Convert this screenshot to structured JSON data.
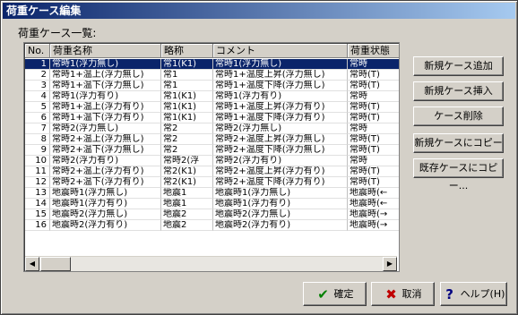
{
  "window": {
    "title": "荷重ケース編集"
  },
  "list_label": "荷重ケース一覧:",
  "columns": [
    "No.",
    "荷重名称",
    "略称",
    "コメント",
    "荷重状態"
  ],
  "rows": [
    [
      "1",
      "常時1(浮力無し)",
      "常1(K1)",
      "常時1(浮力無し)",
      "常時"
    ],
    [
      "2",
      "常時1+温上(浮力無し)",
      "常1",
      "常時1+温度上昇(浮力無し)",
      "常時(T)"
    ],
    [
      "3",
      "常時1+温下(浮力無し)",
      "常1",
      "常時1+温度下降(浮力無し)",
      "常時(T)"
    ],
    [
      "4",
      "常時1(浮力有り)",
      "常1(K1)",
      "常時1(浮力有り)",
      "常時"
    ],
    [
      "5",
      "常時1+温上(浮力有り)",
      "常1(K1)",
      "常時1+温度上昇(浮力有り)",
      "常時(T)"
    ],
    [
      "6",
      "常時1+温下(浮力有り)",
      "常1(K1)",
      "常時1+温度下降(浮力有り)",
      "常時(T)"
    ],
    [
      "7",
      "常時2(浮力無し)",
      "常2",
      "常時2(浮力無し)",
      "常時"
    ],
    [
      "8",
      "常時2+温上(浮力無し)",
      "常2",
      "常時2+温度上昇(浮力無し)",
      "常時(T)"
    ],
    [
      "9",
      "常時2+温下(浮力無し)",
      "常2",
      "常時2+温度下降(浮力無し)",
      "常時(T)"
    ],
    [
      "10",
      "常時2(浮力有り)",
      "常時2(浮",
      "常時2(浮力有り)",
      "常時"
    ],
    [
      "11",
      "常時2+温上(浮力有り)",
      "常2(K1)",
      "常時2+温度上昇(浮力有り)",
      "常時(T)"
    ],
    [
      "12",
      "常時2+温下(浮力有り)",
      "常2(K1)",
      "常時2+温度下降(浮力有り)",
      "常時(T)"
    ],
    [
      "13",
      "地震時1(浮力無し)",
      "地震1",
      "地震時1(浮力無し)",
      "地震時(←"
    ],
    [
      "14",
      "地震時1(浮力有り)",
      "地震1",
      "地震時1(浮力有り)",
      "地震時(←"
    ],
    [
      "15",
      "地震時2(浮力無し)",
      "地震2",
      "地震時2(浮力無し)",
      "地震時(→"
    ],
    [
      "16",
      "地震時2(浮力有り)",
      "地震2",
      "地震時2(浮力有り)",
      "地震時(→"
    ]
  ],
  "side_buttons": [
    "新規ケース追加",
    "新規ケース挿入",
    "ケース削除",
    "新規ケースにコピー",
    "既存ケースにコピー..."
  ],
  "bottom_buttons": {
    "ok": "確定",
    "cancel": "取消",
    "help": "ヘルプ(H)"
  },
  "icons": {
    "ok": "check-icon",
    "cancel": "x-icon",
    "help": "question-icon"
  },
  "colors": {
    "selection": "#0a246a",
    "ok_icon": "#008000",
    "cancel_icon": "#c00000",
    "help_icon": "#000080"
  }
}
